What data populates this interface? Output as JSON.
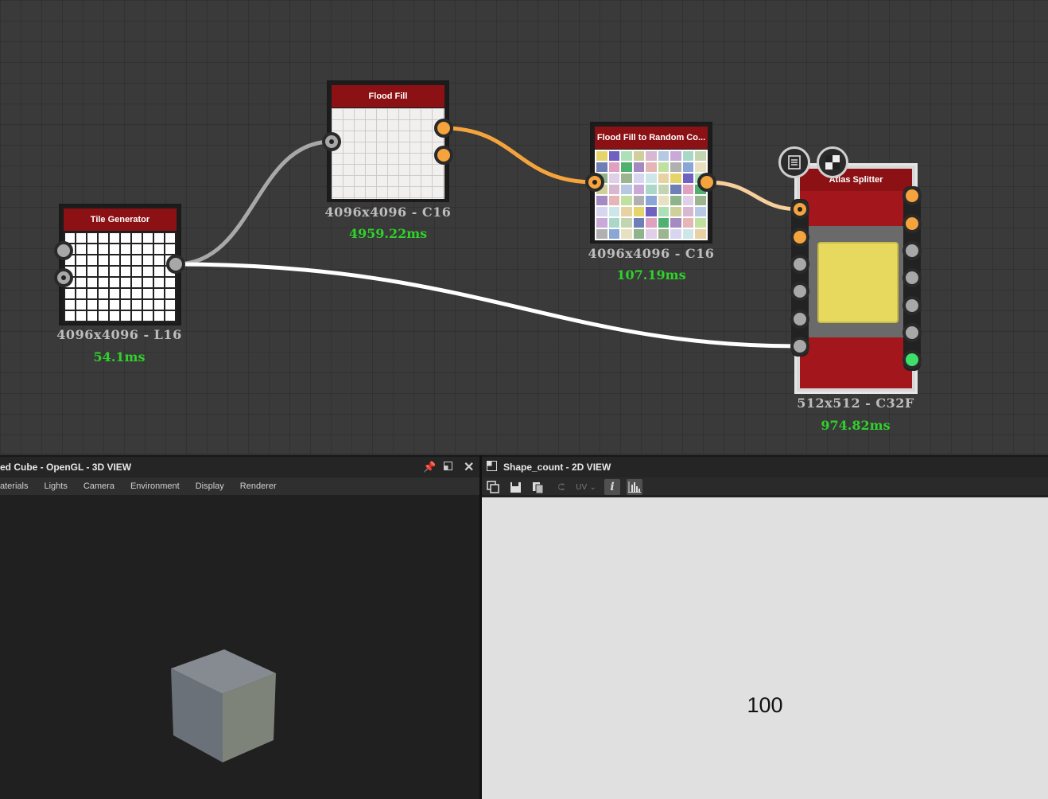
{
  "graph": {
    "nodes": {
      "tile_generator": {
        "title": "Tile Generator",
        "resolution": "4096x4096 - L16",
        "time": "54.1ms"
      },
      "flood_fill": {
        "title": "Flood Fill",
        "resolution": "4096x4096 - C16",
        "time": "4959.22ms"
      },
      "flood_fill_random": {
        "title": "Flood Fill to Random Co...",
        "resolution": "4096x4096 - C16",
        "time": "107.19ms"
      },
      "atlas_splitter": {
        "title": "Atlas Splitter",
        "resolution": "512x512 - C32F",
        "time": "974.82ms"
      }
    },
    "colors": {
      "wire_orange": "#f5a33c",
      "wire_white": "#ffffff",
      "wire_grey": "#a8a8a8",
      "port_orange": "#f5a33c",
      "port_grey": "#a8a8a8",
      "port_green": "#3ee06a",
      "time_green": "#2fd22a"
    }
  },
  "view3d": {
    "title": "ed Cube - OpenGL - 3D VIEW",
    "menu": [
      "aterials",
      "Lights",
      "Camera",
      "Environment",
      "Display",
      "Renderer"
    ],
    "buttons": {
      "pin": "pin-icon",
      "maximize": "maximize-icon",
      "close": "close-icon"
    }
  },
  "view2d": {
    "title": "Shape_count - 2D VIEW",
    "toolbar": {
      "uv_label": "UV"
    },
    "value": "100"
  }
}
